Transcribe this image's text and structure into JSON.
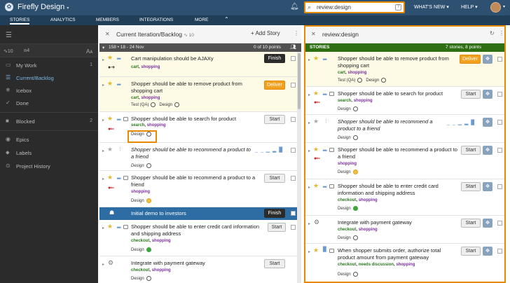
{
  "header": {
    "project_title": "Firefly Design",
    "search_value": "review:design",
    "nav": [
      "WHAT'S NEW",
      "HELP"
    ]
  },
  "tabs": [
    "STORIES",
    "ANALYTICS",
    "MEMBERS",
    "INTEGRATIONS",
    "MORE"
  ],
  "sidebar": {
    "stats": {
      "velocity": "10",
      "members": "4"
    },
    "items": [
      {
        "label": "My Work",
        "count": "1"
      },
      {
        "label": "Current/Backlog",
        "count": ""
      },
      {
        "label": "Icebox",
        "count": ""
      },
      {
        "label": "Done",
        "count": ""
      },
      {
        "label": "Blocked",
        "count": "2"
      },
      {
        "label": "Epics",
        "count": ""
      },
      {
        "label": "Labels",
        "count": ""
      },
      {
        "label": "Project History",
        "count": ""
      }
    ]
  },
  "backlog": {
    "title": "Current Iteration/Backlog",
    "velocity": "10",
    "add_story": "Add Story",
    "iteration": {
      "label": "158 • 18 - 24 Nov",
      "points": "0 of 10 points"
    },
    "stories": [
      {
        "title": "Cart manipulation should be AJAXy",
        "labels": [
          "cart",
          "shopping"
        ],
        "button": "Finish"
      },
      {
        "title": "Shopper should be able to remove product from shopping cart",
        "labels": [
          "cart",
          "shopping"
        ],
        "reviews": [
          "Test (QA)",
          "Design"
        ],
        "button": "Deliver"
      },
      {
        "title": "Shopper should be able to search for product",
        "labels": [
          "search",
          "shopping"
        ],
        "reviews": [
          "Design"
        ],
        "button": "Start"
      },
      {
        "title": "Shopper should be able to recommend a product to a friend",
        "labels": [],
        "reviews": [
          "Design"
        ]
      },
      {
        "title": "Shopper should be able to recommend a product to a friend",
        "labels": [
          "shopping"
        ],
        "reviews": [
          "Design"
        ],
        "button": "Start"
      },
      {
        "title": "Initial demo to investors",
        "button": "Finish"
      },
      {
        "title": "Shopper should be able to enter credit card information and shipping address",
        "labels": [
          "checkout",
          "shopping"
        ],
        "reviews": [
          "Design"
        ],
        "button": "Start"
      },
      {
        "title": "Integrate with payment gateway",
        "labels": [
          "checkout",
          "shopping"
        ],
        "reviews": [
          "Design"
        ],
        "button": "Start"
      }
    ]
  },
  "review": {
    "title": "review:design",
    "strip_label": "STORIES",
    "strip_count": "7 stories, 8 points",
    "stories": [
      {
        "title": "Shopper should be able to remove product from shopping cart",
        "labels": [
          "cart",
          "shopping"
        ],
        "reviews": [
          "Test (QA)",
          "Design"
        ],
        "button": "Deliver"
      },
      {
        "title": "Shopper should be able to search for product",
        "labels": [
          "search",
          "shopping"
        ],
        "reviews": [
          "Design"
        ],
        "button": "Start"
      },
      {
        "title": "Shopper should be able to recommend a product to a friend",
        "labels": [],
        "reviews": [
          "Design"
        ]
      },
      {
        "title": "Shopper should be able to recommend a product to a friend",
        "labels": [
          "shopping"
        ],
        "reviews": [
          "Design"
        ],
        "button": "Start"
      },
      {
        "title": "Shopper should be able to enter credit card information and shipping address",
        "labels": [
          "checkout",
          "shopping"
        ],
        "reviews": [
          "Design"
        ],
        "button": "Start"
      },
      {
        "title": "Integrate with payment gateway",
        "labels": [
          "checkout",
          "shopping"
        ],
        "reviews": [
          "Design"
        ],
        "button": "Start"
      },
      {
        "title": "When shopper submits order, authorize total product amount from payment gateway",
        "labels": [
          "checkout",
          "needs discussion",
          "shopping"
        ],
        "reviews": [
          "Design"
        ],
        "button": "Start"
      }
    ]
  },
  "colors": {
    "topbar": "#2f5171",
    "highlight": "#e68a00",
    "deliver": "#f2a11f",
    "epic": "#2e6da4",
    "strip": "#2e6f14"
  }
}
